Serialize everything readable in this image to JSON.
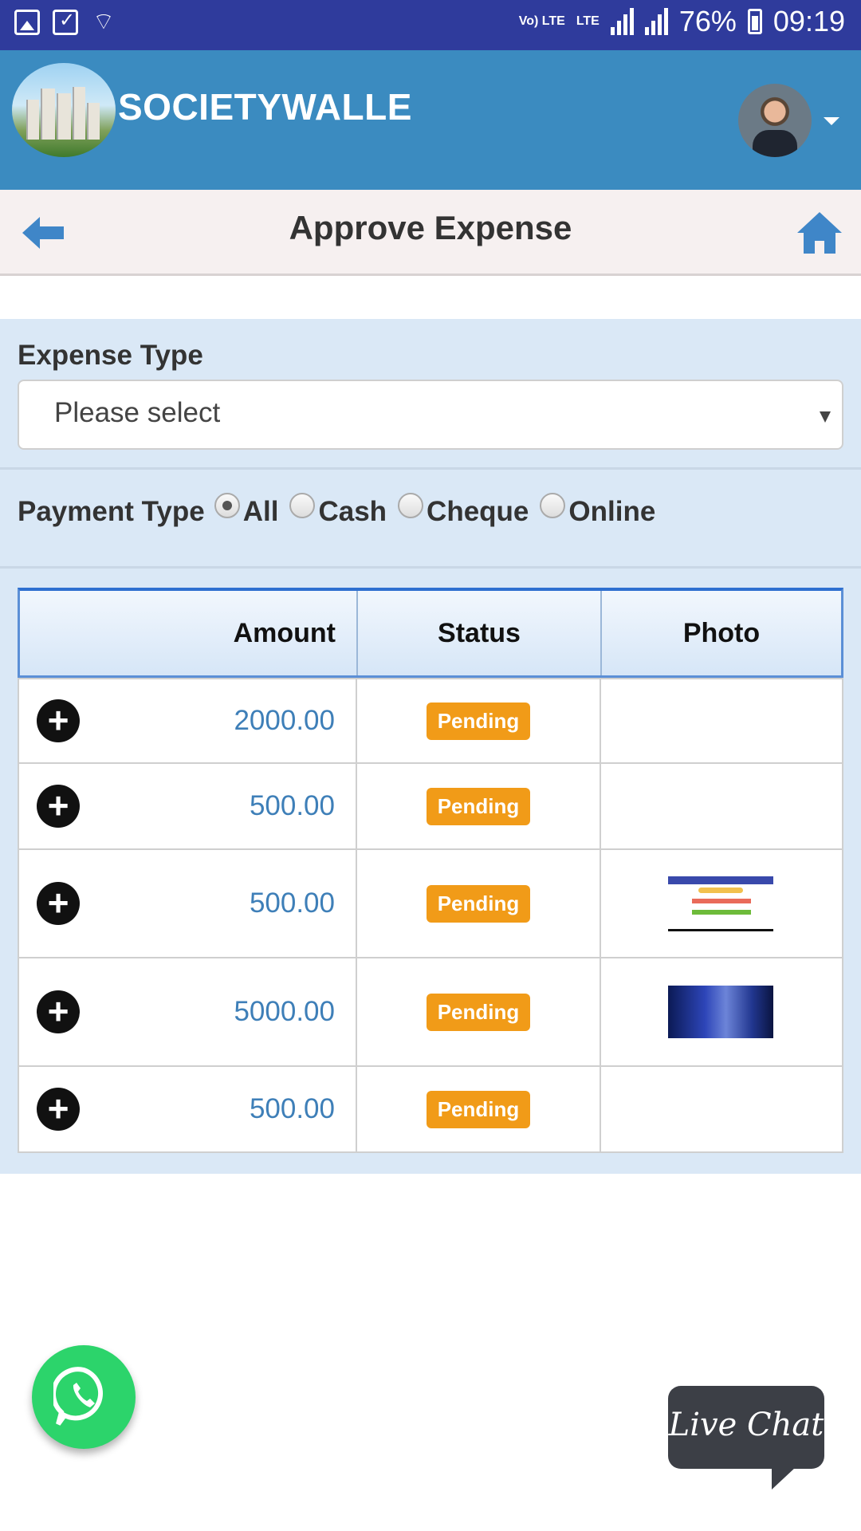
{
  "status_bar": {
    "network_small": "Vo) LTE",
    "lte": "LTE",
    "battery": "76%",
    "time": "09:19"
  },
  "header": {
    "brand": "SOCIETYWALLE"
  },
  "title_bar": {
    "title": "Approve Expense"
  },
  "filters": {
    "expense_type_label": "Expense Type",
    "expense_type_placeholder": "Please select",
    "payment_type_label": "Payment Type",
    "payment_options": [
      {
        "label": "All",
        "selected": true
      },
      {
        "label": "Cash",
        "selected": false
      },
      {
        "label": "Cheque",
        "selected": false
      },
      {
        "label": "Online",
        "selected": false
      }
    ]
  },
  "table": {
    "headers": {
      "amount": "Amount",
      "status": "Status",
      "photo": "Photo"
    },
    "rows": [
      {
        "amount": "2000.00",
        "status": "Pending",
        "photo": ""
      },
      {
        "amount": "500.00",
        "status": "Pending",
        "photo": ""
      },
      {
        "amount": "500.00",
        "status": "Pending",
        "photo": "screenshot-thumbnail"
      },
      {
        "amount": "5000.00",
        "status": "Pending",
        "photo": "dark-photo-thumbnail"
      },
      {
        "amount": "500.00",
        "status": "Pending",
        "photo": ""
      }
    ]
  },
  "widgets": {
    "live_chat": "Live Chat"
  },
  "colors": {
    "status_bar": "#2f3b9c",
    "app_bar": "#3b8bc0",
    "panel": "#dae8f6",
    "badge": "#f19b18",
    "amount": "#3e7fb8",
    "whatsapp": "#2cd46b"
  }
}
